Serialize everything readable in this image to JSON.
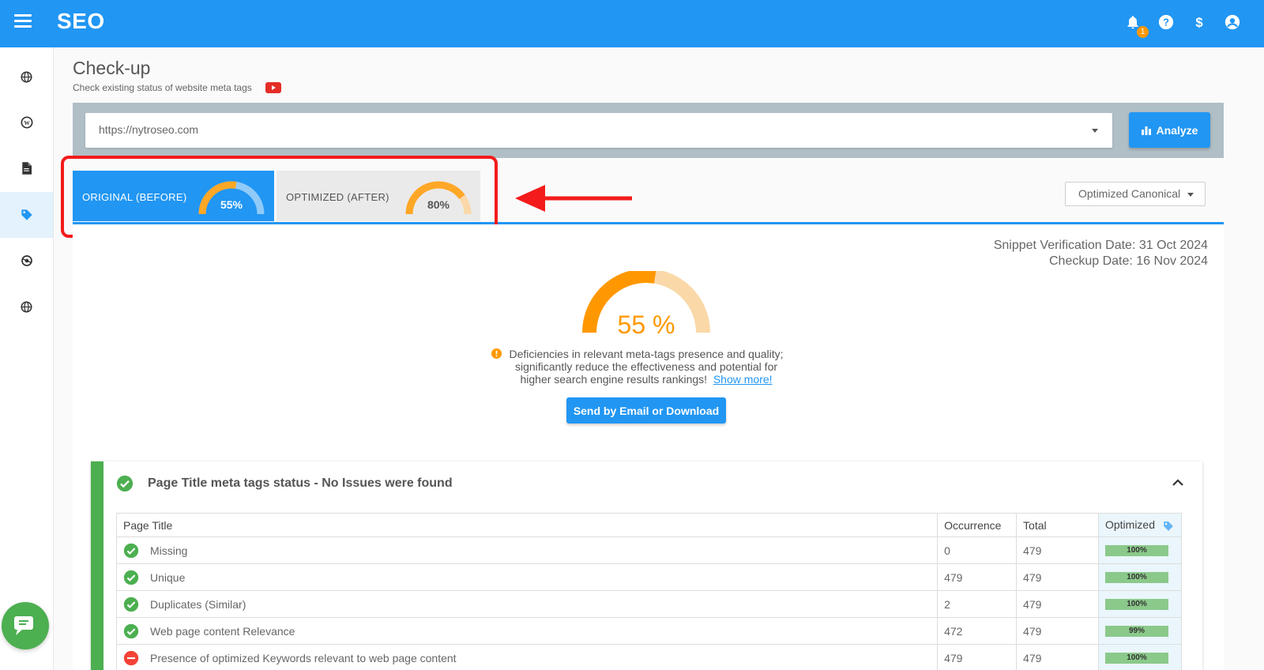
{
  "app": {
    "title": "SEO",
    "notification_count": "1"
  },
  "page": {
    "title": "Check-up",
    "subtitle": "Check existing status of website meta tags"
  },
  "search": {
    "url": "https://nytroseo.com",
    "analyze_label": "Analyze"
  },
  "tabs": [
    {
      "label": "ORIGINAL (BEFORE)",
      "score": "55%",
      "value": 55
    },
    {
      "label": "OPTIMIZED (AFTER)",
      "score": "80%",
      "value": 80
    }
  ],
  "canonical_select": {
    "selected": "Optimized Canonical"
  },
  "dates": {
    "snippet": "Snippet Verification Date: 31 Oct 2024",
    "checkup": "Checkup Date: 16 Nov 2024"
  },
  "overall": {
    "score_text": "55 %",
    "value": 55,
    "warning": "Deficiencies in relevant meta-tags presence and quality; significantly reduce the effectiveness and potential for higher search engine results rankings!",
    "show_more": "Show more!",
    "send_label": "Send by Email or Download"
  },
  "section": {
    "title": "Page Title meta tags status - No Issues were found",
    "columns": [
      "Page Title",
      "Occurrence",
      "Total",
      "Optimized"
    ],
    "rows": [
      {
        "label": "Missing",
        "occurrence": "0",
        "total": "479",
        "optimized": "100%",
        "status": "ok"
      },
      {
        "label": "Unique",
        "occurrence": "479",
        "total": "479",
        "optimized": "100%",
        "status": "ok"
      },
      {
        "label": "Duplicates (Similar)",
        "occurrence": "2",
        "total": "479",
        "optimized": "100%",
        "status": "ok"
      },
      {
        "label": "Web page content Relevance",
        "occurrence": "472",
        "total": "479",
        "optimized": "99%",
        "status": "ok"
      },
      {
        "label": "Presence of optimized Keywords relevant to web page content",
        "occurrence": "479",
        "total": "479",
        "optimized": "100%",
        "status": "error"
      }
    ]
  },
  "colors": {
    "primary": "#2196f3",
    "accent": "#ff9800",
    "success": "#4caf50",
    "highlight": "#f31b1b"
  },
  "icons": {
    "menu": "menu-icon",
    "notifications": "bell-icon",
    "help": "help-icon",
    "billing": "dollar-icon",
    "account": "account-icon",
    "chat": "chat-icon"
  }
}
